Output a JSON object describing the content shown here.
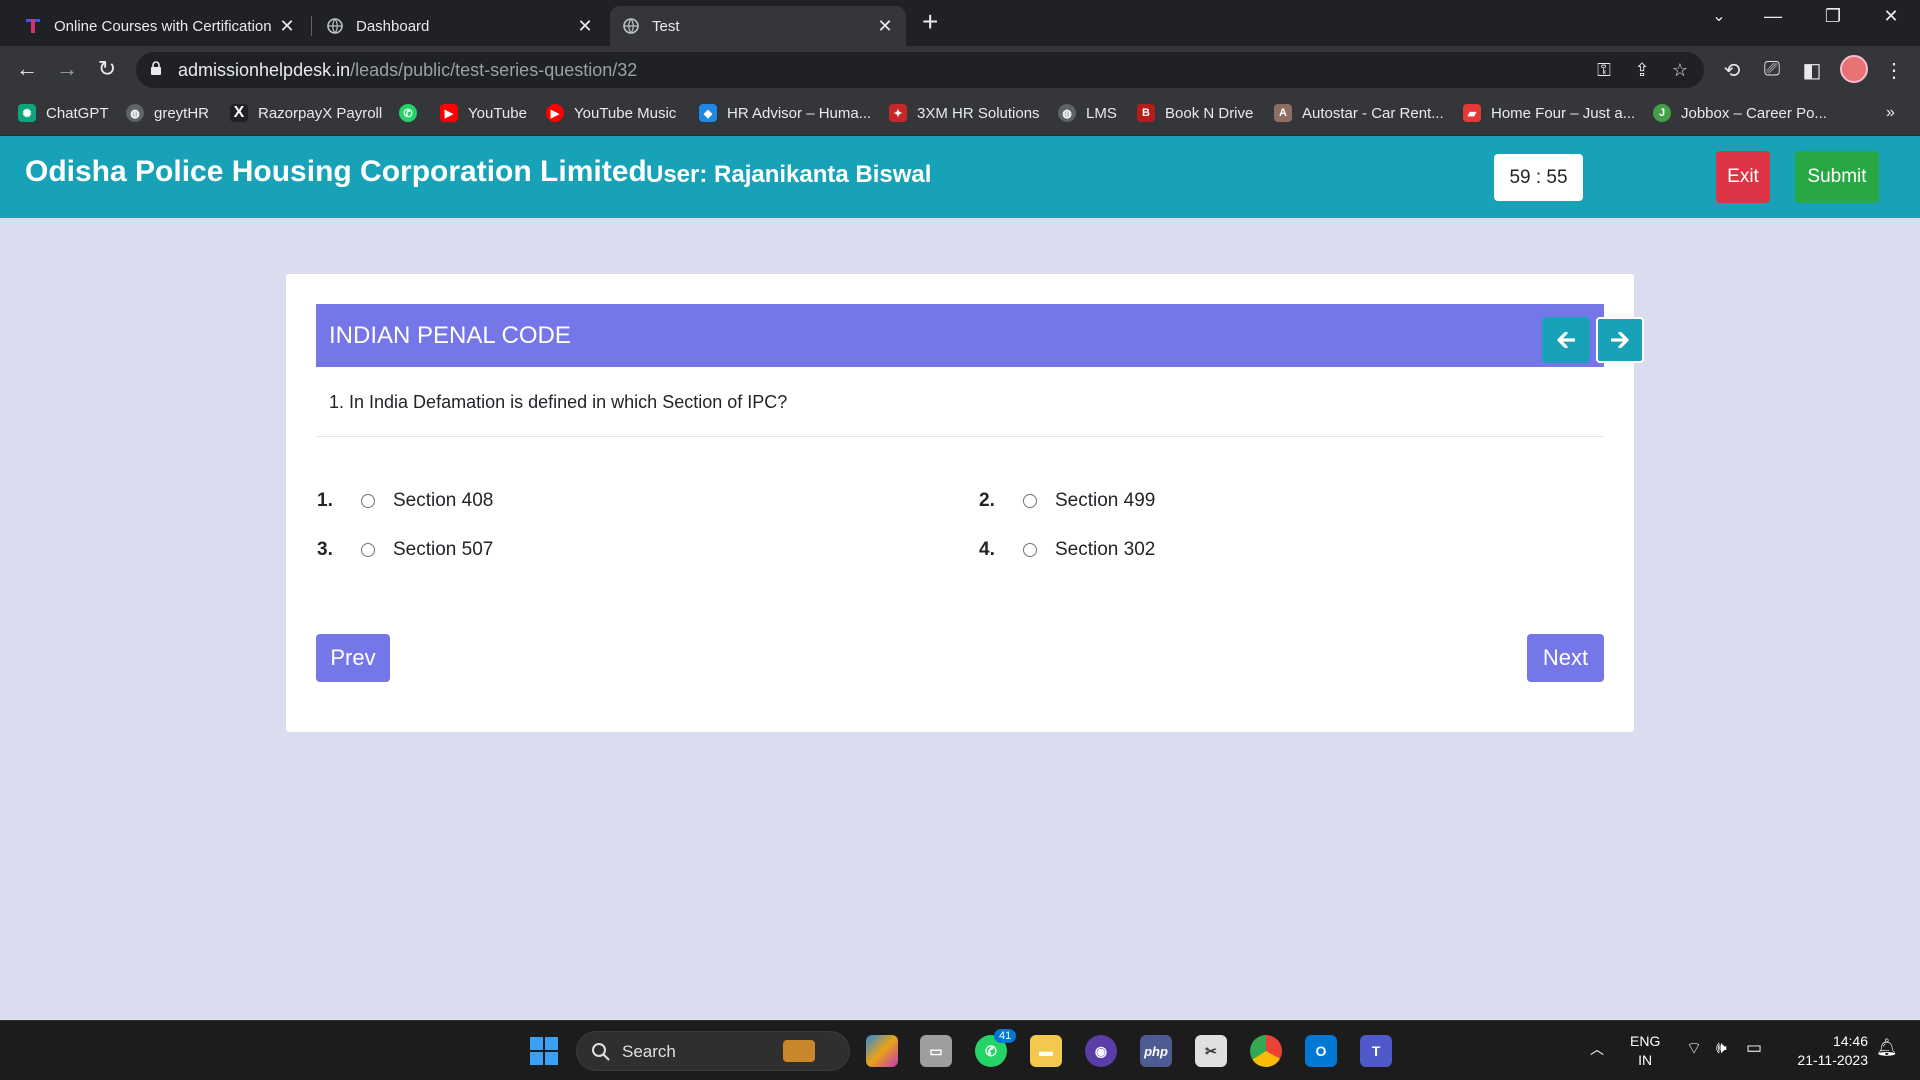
{
  "browser": {
    "tabs": [
      {
        "title": "Online Courses with Certification",
        "icon": "t-logo-icon",
        "active": false
      },
      {
        "title": "Dashboard",
        "icon": "globe-icon",
        "active": false
      },
      {
        "title": "Test",
        "icon": "globe-icon",
        "active": true
      }
    ],
    "url_host": "admissionhelpdesk.in",
    "url_path": "/leads/public/test-series-question/32",
    "bookmarks": [
      {
        "label": "ChatGPT",
        "icon": "chatgpt-icon",
        "color": "#10a37f"
      },
      {
        "label": "greytHR",
        "icon": "globe-icon",
        "color": "#5f6368"
      },
      {
        "label": "RazorpayX Payroll",
        "icon": "x-logo-icon",
        "color": "#202124"
      },
      {
        "label": "",
        "icon": "whatsapp-icon",
        "color": "#25d366"
      },
      {
        "label": "YouTube",
        "icon": "youtube-icon",
        "color": "#ff0000"
      },
      {
        "label": "YouTube Music",
        "icon": "youtube-music-icon",
        "color": "#ff0000"
      },
      {
        "label": "HR Advisor – Huma...",
        "icon": "hr-advisor-icon",
        "color": "#1e88e5"
      },
      {
        "label": "3XM HR Solutions",
        "icon": "3xm-icon",
        "color": "#c62828"
      },
      {
        "label": "LMS",
        "icon": "globe-icon",
        "color": "#5f6368"
      },
      {
        "label": "Book N Drive",
        "icon": "book-n-drive-icon",
        "color": "#b71c1c"
      },
      {
        "label": "Autostar - Car Rent...",
        "icon": "autostar-icon",
        "color": "#8d6e63"
      },
      {
        "label": "Home Four – Just a...",
        "icon": "car-icon",
        "color": "#e53935"
      },
      {
        "label": "Jobbox – Career Po...",
        "icon": "jobbox-icon",
        "color": "#43a047"
      }
    ]
  },
  "app": {
    "org_name": "Odisha Police Housing Corporation Limited",
    "user_label": "User: Rajanikanta Biswal",
    "timer": "59 : 55",
    "exit_label": "Exit",
    "submit_label": "Submit",
    "section_title": "INDIAN PENAL CODE",
    "question": "1. In India Defamation is defined in which Section of IPC?",
    "options": [
      {
        "num": "1.",
        "text": "Section 408"
      },
      {
        "num": "2.",
        "text": "Section 499"
      },
      {
        "num": "3.",
        "text": "Section 507"
      },
      {
        "num": "4.",
        "text": "Section 302"
      }
    ],
    "prev_label": "Prev",
    "next_label": "Next"
  },
  "taskbar": {
    "search_label": "Search",
    "whatsapp_badge": "41",
    "lang_line1": "ENG",
    "lang_line2": "IN",
    "time": "14:46",
    "date": "21-11-2023"
  },
  "colors": {
    "header_teal": "#17a2b8",
    "card_header": "#7576e8",
    "exit_red": "#dc3545",
    "submit_green": "#28a745",
    "page_bg": "#d9ddef"
  }
}
